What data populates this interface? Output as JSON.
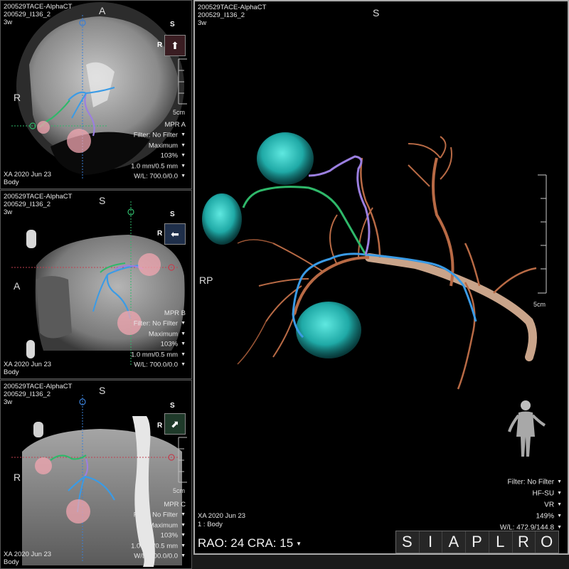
{
  "viewports": {
    "mpr_a": {
      "study": "200529TACE-AlphaCT",
      "series": "200529_I136_2",
      "age": "3w",
      "orient_top": "A",
      "orient_left": "R",
      "cube_top": "S",
      "cube_side": "R",
      "scale": "5cm",
      "mpr_label": "MPR A",
      "filter": "Filter: No Filter",
      "projection": "Maximum",
      "zoom": "103%",
      "thickness": "1.0 mm/0.5 mm",
      "wl": "W/L: 700.0/0.0",
      "modality_date": "XA  2020 Jun 23",
      "body": "Body"
    },
    "mpr_b": {
      "study": "200529TACE-AlphaCT",
      "series": "200529_I136_2",
      "age": "3w",
      "orient_top": "S",
      "orient_left": "A",
      "cube_top": "S",
      "cube_side": "R",
      "mpr_label": "MPR B",
      "filter": "Filter: No Filter",
      "projection": "Maximum",
      "zoom": "103%",
      "thickness": "1.0 mm/0.5 mm",
      "wl": "W/L: 700.0/0.0",
      "modality_date": "XA  2020 Jun 23",
      "body": "Body"
    },
    "mpr_c": {
      "study": "200529TACE-AlphaCT",
      "series": "200529_I136_2",
      "age": "3w",
      "orient_top": "S",
      "orient_left": "R",
      "cube_top": "S",
      "cube_side": "R",
      "scale": "5cm",
      "mpr_label": "MPR C",
      "filter": "Filter: No Filter",
      "projection": "Maximum",
      "zoom": "103%",
      "thickness": "1.0 mm/0.5 mm",
      "wl": "W/L: 700.0/0.0",
      "modality_date": "XA  2020 Jun 23",
      "body": "Body"
    },
    "vr": {
      "study": "200529TACE-AlphaCT",
      "series": "200529_I136_2",
      "age": "3w",
      "orient_top": "S",
      "orient_left": "RP",
      "scale": "5cm",
      "filter": "Filter: No Filter",
      "preset": "HF-SU",
      "render_mode": "VR",
      "zoom": "149%",
      "wl": "W/L: 472.9/144.8",
      "modality_date": "XA  2020 Jun 23",
      "series_label": "1 : Body",
      "angle": "RAO: 24  CRA: 15"
    }
  },
  "orientation_buttons": [
    "S",
    "I",
    "A",
    "P",
    "L",
    "R",
    "O"
  ],
  "colors": {
    "vessel_blue": "#3a9be6",
    "vessel_green": "#2fb86a",
    "vessel_purple": "#9b7fe0",
    "tumor_pink": "#f2a5b0",
    "tumor_cyan": "#2fc9c4",
    "artery_copper": "#b86a45"
  }
}
